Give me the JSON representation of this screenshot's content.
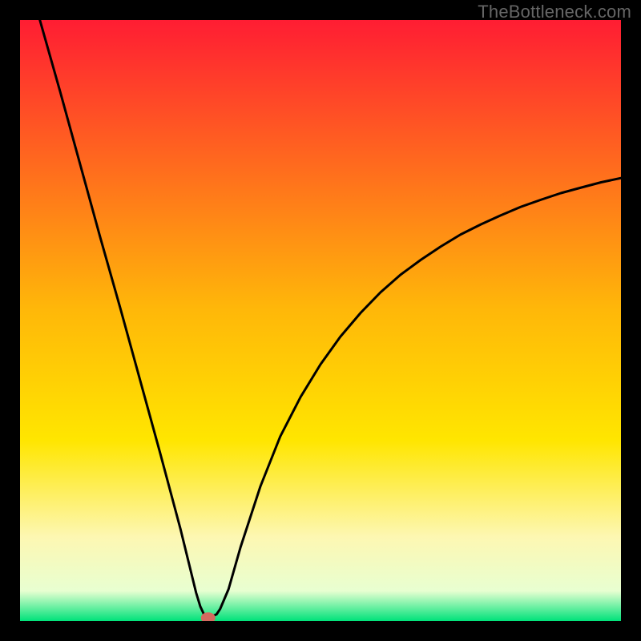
{
  "watermark": "TheBottleneck.com",
  "chart_data": {
    "type": "line",
    "title": "",
    "xlabel": "",
    "ylabel": "",
    "xlim": [
      0,
      100
    ],
    "ylim": [
      0,
      100
    ],
    "grid": false,
    "legend": false,
    "background_gradient": {
      "stops": [
        {
          "offset": 0.0,
          "color": "#ff1d33"
        },
        {
          "offset": 0.48,
          "color": "#ffb709"
        },
        {
          "offset": 0.7,
          "color": "#ffe600"
        },
        {
          "offset": 0.86,
          "color": "#fdf7b2"
        },
        {
          "offset": 0.95,
          "color": "#e8ffd1"
        },
        {
          "offset": 1.0,
          "color": "#00e27a"
        }
      ]
    },
    "series": [
      {
        "name": "curve",
        "color": "#000000",
        "x": [
          3.3,
          6.7,
          10.0,
          13.3,
          16.7,
          20.0,
          23.3,
          26.7,
          28.0,
          29.3,
          30.0,
          30.7,
          31.3,
          32.7,
          33.3,
          34.7,
          36.7,
          40.0,
          43.3,
          46.7,
          50.0,
          53.3,
          56.7,
          60.0,
          63.3,
          66.7,
          70.0,
          73.3,
          76.7,
          80.0,
          83.3,
          86.7,
          90.0,
          93.3,
          96.7,
          100.0
        ],
        "y": [
          100.0,
          88.0,
          76.0,
          64.0,
          52.0,
          40.0,
          28.0,
          15.3,
          10.0,
          4.7,
          2.4,
          0.9,
          0.5,
          1.1,
          2.0,
          5.3,
          12.3,
          22.4,
          30.7,
          37.3,
          42.7,
          47.3,
          51.3,
          54.7,
          57.6,
          60.1,
          62.3,
          64.3,
          66.0,
          67.5,
          68.9,
          70.1,
          71.2,
          72.1,
          73.0,
          73.7
        ]
      }
    ],
    "marker": {
      "x": 31.3,
      "y": 0.5,
      "color": "#d46a5f",
      "rx": 9,
      "ry": 7
    }
  }
}
